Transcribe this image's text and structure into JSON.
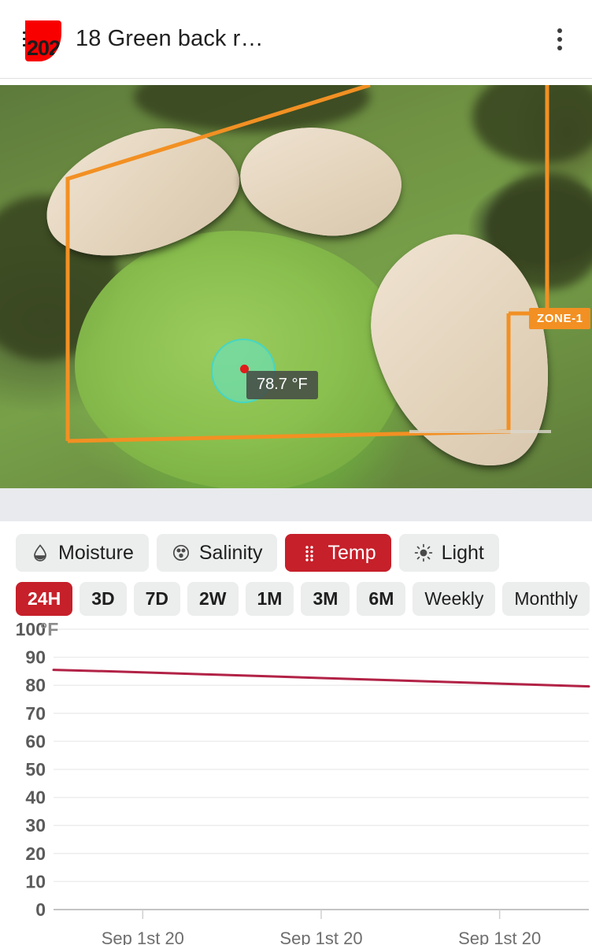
{
  "app": {
    "title": "18 Green back r…",
    "menu_icon": "hamburger-icon",
    "badge_text": "202",
    "overflow_icon": "kebab-menu-icon"
  },
  "map": {
    "zone_label": "ZONE-1",
    "sensor_reading": "78.7 °F",
    "zone_color": "#f29023",
    "sensor_color": "#45d6c4",
    "sensor_dot_color": "#e01b1b"
  },
  "metrics": {
    "items": [
      {
        "label": "Moisture",
        "icon": "water-drop-icon",
        "active": false
      },
      {
        "label": "Salinity",
        "icon": "salinity-icon",
        "active": false
      },
      {
        "label": "Temp",
        "icon": "temp-grid-icon",
        "active": true
      },
      {
        "label": "Light",
        "icon": "sun-icon",
        "active": false
      }
    ],
    "active_color": "#c6202a"
  },
  "ranges": {
    "items": [
      {
        "label": "24H",
        "active": true
      },
      {
        "label": "3D",
        "active": false
      },
      {
        "label": "7D",
        "active": false
      },
      {
        "label": "2W",
        "active": false
      },
      {
        "label": "1M",
        "active": false
      },
      {
        "label": "3M",
        "active": false
      },
      {
        "label": "6M",
        "active": false
      },
      {
        "label": "Weekly",
        "active": false
      },
      {
        "label": "Monthly",
        "active": false
      }
    ]
  },
  "chart_data": {
    "type": "line",
    "title": "",
    "xlabel": "",
    "ylabel": "°F",
    "unit": "°F",
    "ylim": [
      0,
      100
    ],
    "yticks": [
      100,
      90,
      80,
      70,
      60,
      50,
      40,
      30,
      20,
      10,
      0
    ],
    "xticks": [
      "Sep 1st 20",
      "Sep 1st 20",
      "Sep 1st 20"
    ],
    "grid": true,
    "legend": "none",
    "line_color": "#b22246",
    "series": [
      {
        "name": "Temp",
        "values": [
          85.5,
          85.0,
          84.4,
          83.8,
          83.2,
          82.6,
          82.0,
          81.4,
          80.8,
          80.2,
          79.6
        ]
      }
    ],
    "x": [
      0,
      1,
      2,
      3,
      4,
      5,
      6,
      7,
      8,
      9,
      10
    ]
  }
}
